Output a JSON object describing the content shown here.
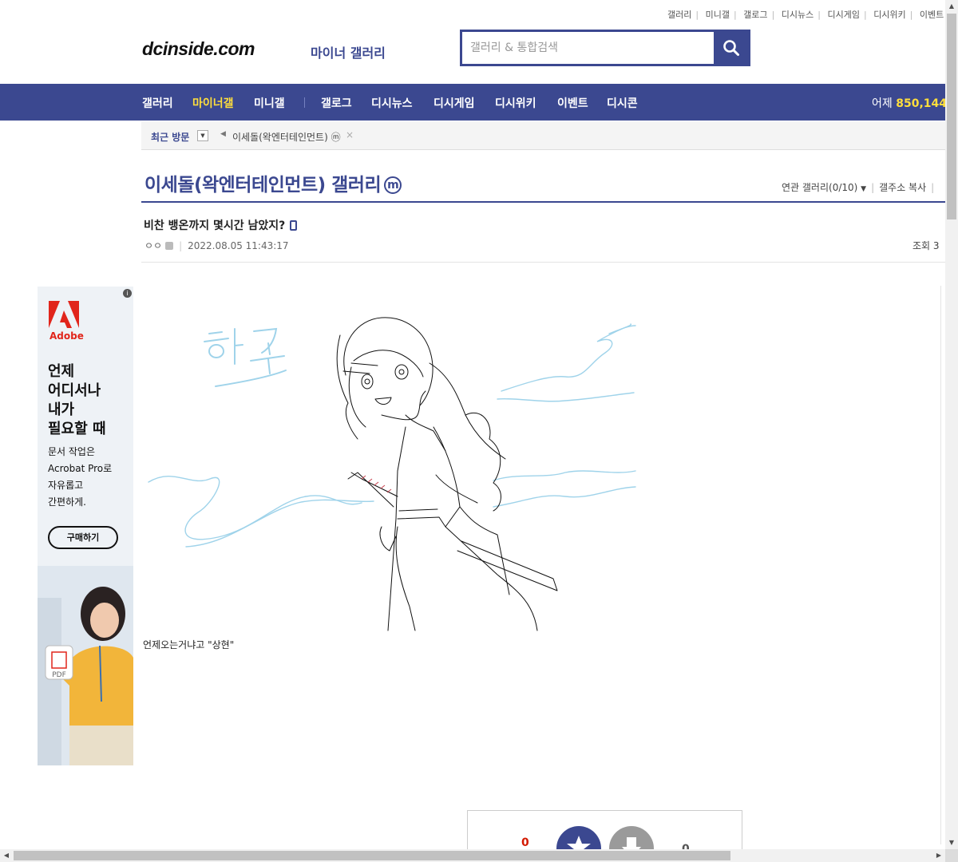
{
  "util_links": [
    "갤러리",
    "미니갤",
    "갤로그",
    "디시뉴스",
    "디시게임",
    "디시위키",
    "이벤트"
  ],
  "logo": {
    "text": "dcinside.com",
    "sub": "마이너 갤러리"
  },
  "search": {
    "placeholder": "갤러리 & 통합검색"
  },
  "nav": {
    "items": [
      "갤러리",
      "마이너갤",
      "미니갤",
      "갤로그",
      "디시뉴스",
      "디시게임",
      "디시위키",
      "이벤트",
      "디시콘"
    ],
    "active": "마이너갤",
    "yesterday_label": "어제",
    "yesterday_value": "850,144"
  },
  "recent": {
    "label": "최근 방문",
    "toggle": "▼",
    "prev": "◀",
    "item": "이세돌(왁엔터테인먼트) ⓜ",
    "close": "×"
  },
  "gallery": {
    "title": "이세돌(왁엔터테인먼트) 갤러리",
    "badge": "m",
    "related": "연관 갤러리(0/10)",
    "related_caret": "▼",
    "copy_address": "갤주소 복사"
  },
  "post": {
    "subject": "비찬 뱅온까지 몇시간 남았지?",
    "author": "ㅇㅇ",
    "date": "2022.08.05 11:43:17",
    "views": "조회 3",
    "text": "언제오는거냐고 \"상현\"",
    "drawing_caption": "하주"
  },
  "ad": {
    "info": "i",
    "brand": "Adobe",
    "headline": [
      "언제",
      "어디서나",
      "내가",
      "필요할 때"
    ],
    "body": [
      "문서 작업은",
      "Acrobat Pro로",
      "자유롭고",
      "간편하게."
    ],
    "cta": "구매하기",
    "pdf_label": "PDF"
  },
  "recommend": {
    "up_count": "0",
    "down_count": "0"
  },
  "colors": {
    "brand": "#3b4890",
    "active_nav": "#ffde3c",
    "up_count": "#d31900",
    "adobe_red": "#e1251b"
  },
  "icons": [
    "search-icon",
    "mobile-icon",
    "star-icon",
    "thumbs-down-icon",
    "info-icon",
    "adobe-logo-icon",
    "pdf-icon"
  ]
}
